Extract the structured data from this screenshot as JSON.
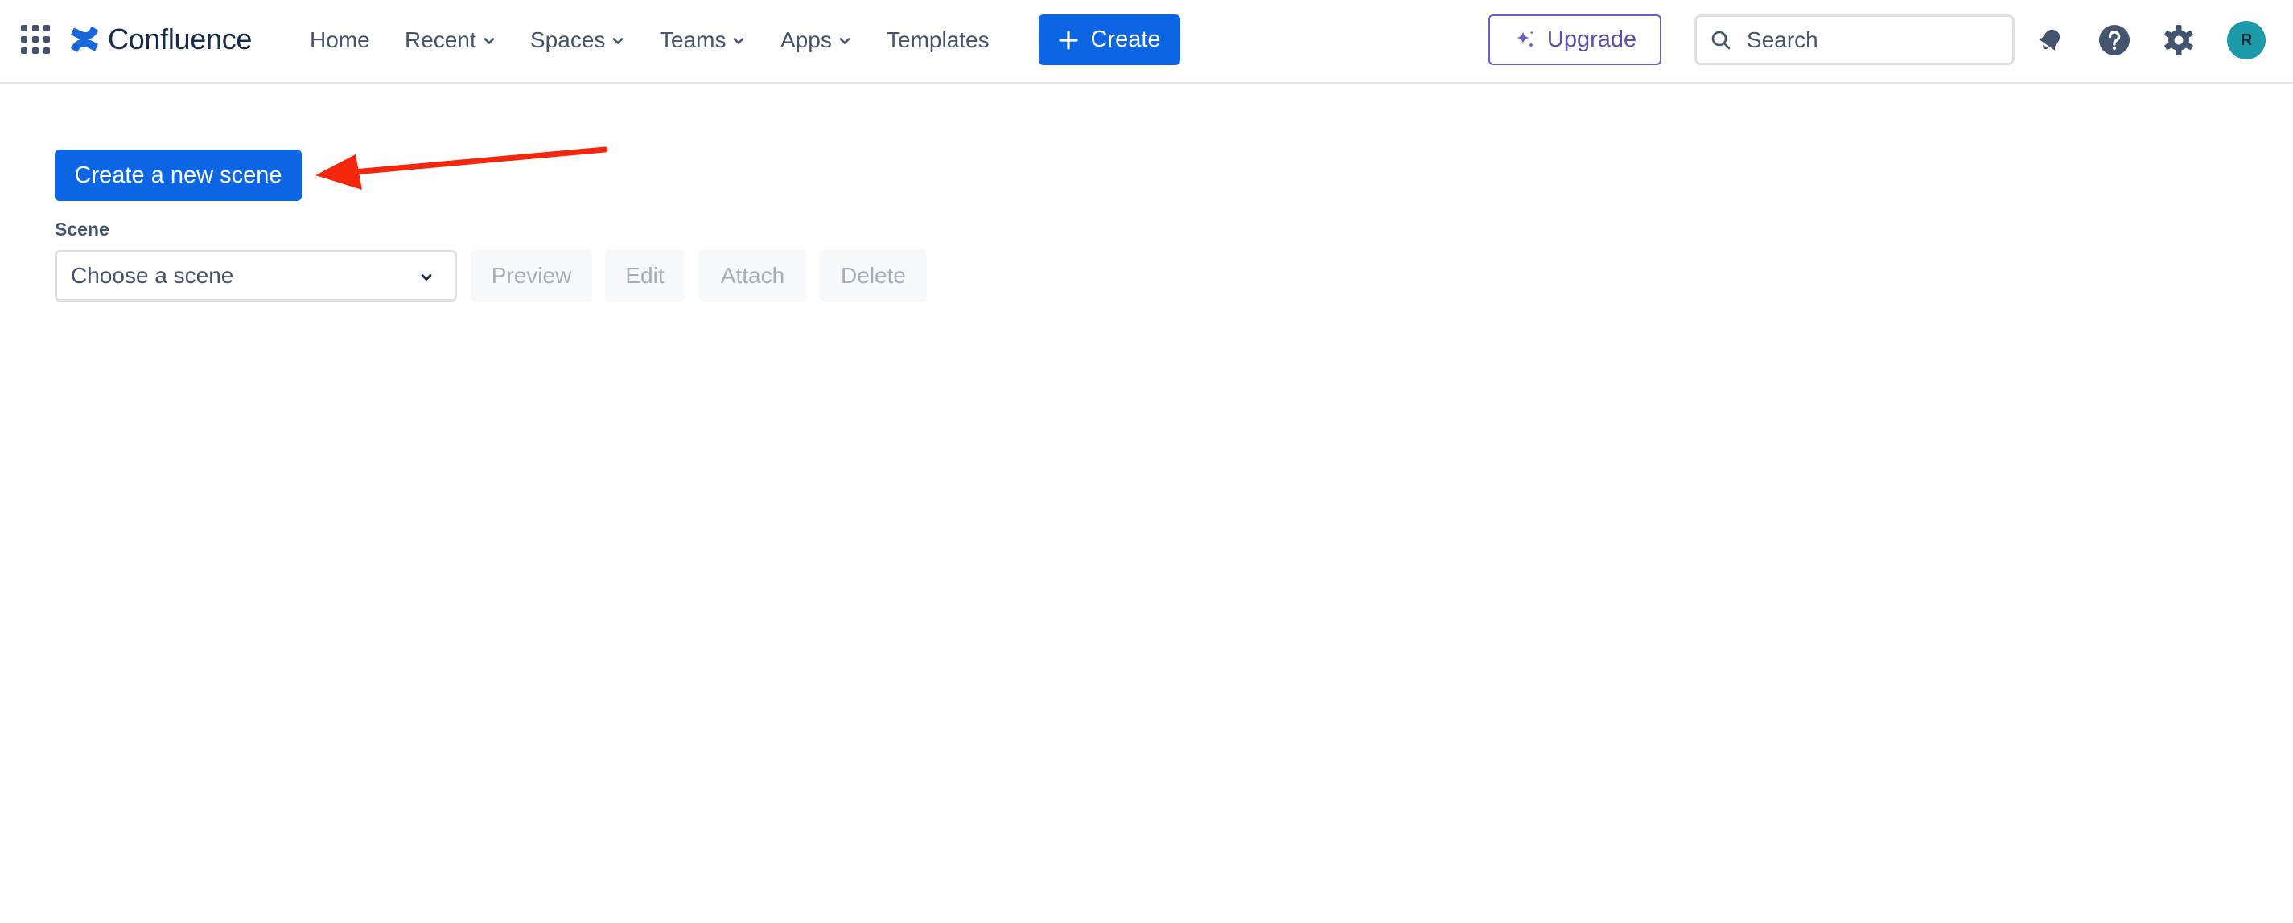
{
  "header": {
    "brand": "Confluence",
    "nav": [
      {
        "label": "Home",
        "has_dropdown": false
      },
      {
        "label": "Recent",
        "has_dropdown": true
      },
      {
        "label": "Spaces",
        "has_dropdown": true
      },
      {
        "label": "Teams",
        "has_dropdown": true
      },
      {
        "label": "Apps",
        "has_dropdown": true
      },
      {
        "label": "Templates",
        "has_dropdown": false
      }
    ],
    "create_label": "Create",
    "upgrade_label": "Upgrade",
    "search": {
      "placeholder": "Search",
      "value": ""
    },
    "avatar_initial": "R",
    "icons": [
      "app-switcher-icon",
      "confluence-logo-icon",
      "notifications-icon",
      "help-icon",
      "settings-icon"
    ]
  },
  "main": {
    "create_scene_label": "Create a new scene",
    "scene_label": "Scene",
    "scene_select": {
      "selected": "Choose a scene"
    },
    "actions": [
      {
        "label": "Preview",
        "disabled": true
      },
      {
        "label": "Edit",
        "disabled": true
      },
      {
        "label": "Attach",
        "disabled": true
      },
      {
        "label": "Delete",
        "disabled": true
      }
    ]
  },
  "colors": {
    "primary": "#0c66e4",
    "upgrade": "#6e5dc6",
    "annotation_arrow": "#f4260c",
    "avatar": "#1d9aaa"
  }
}
